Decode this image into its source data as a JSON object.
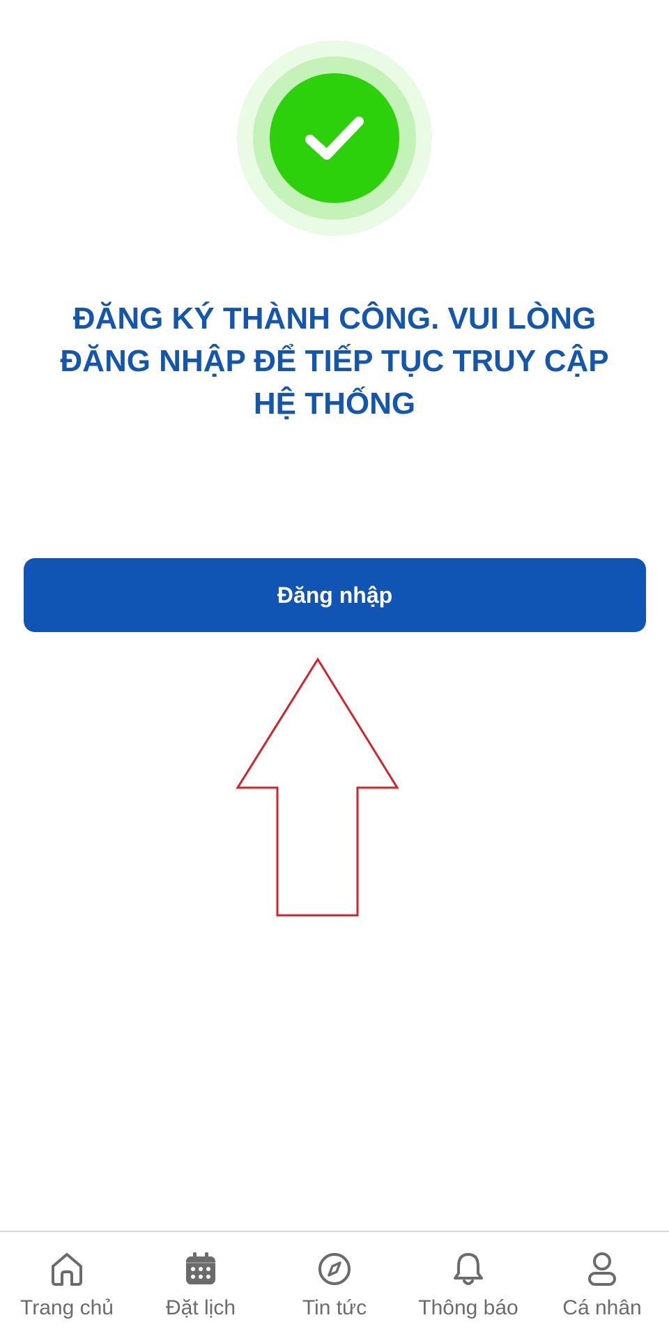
{
  "success": {
    "icon": "check-icon",
    "colors": {
      "outer_ring": "#e9fbe5",
      "mid_ring": "#c4f2b8",
      "inner_circle": "#2dd10b"
    },
    "message_lines": [
      "ĐĂNG KÝ THÀNH CÔNG. VUI LÒNG",
      "ĐĂNG NHẬP ĐỂ TIẾP TỤC TRUY CẬP",
      "HỆ THỐNG"
    ],
    "message_color": "#1556ad"
  },
  "login_button": {
    "label": "Đăng nhập",
    "color": "#1155b4"
  },
  "annotation": {
    "icon": "up-arrow-icon",
    "color": "#d0242b"
  },
  "bottom_nav": {
    "items": [
      {
        "label": "Trang chủ",
        "icon": "home-icon"
      },
      {
        "label": "Đặt lịch",
        "icon": "calendar-icon"
      },
      {
        "label": "Tin tức",
        "icon": "compass-icon"
      },
      {
        "label": "Thông báo",
        "icon": "bell-icon"
      },
      {
        "label": "Cá nhân",
        "icon": "user-icon"
      }
    ],
    "label_color": "#6b6b6b"
  }
}
